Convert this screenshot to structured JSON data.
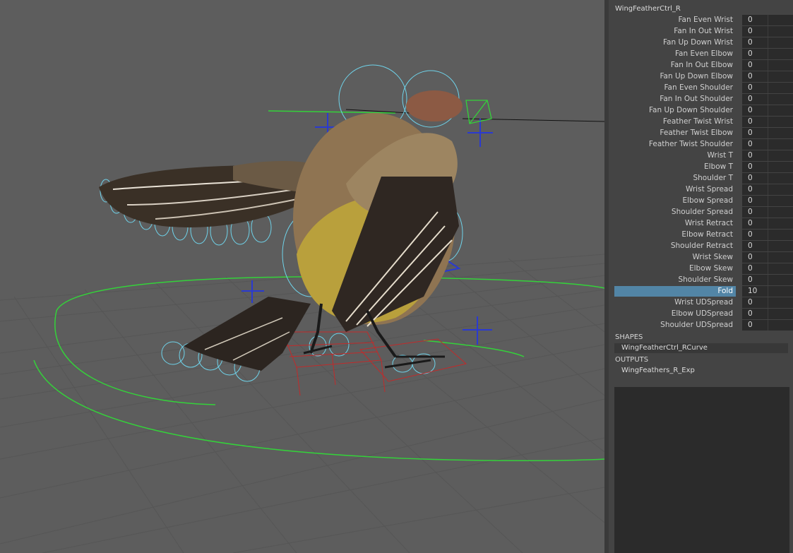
{
  "node_name": "WingFeatherCtrl_R",
  "attributes": [
    {
      "label": "Fan Even Wrist",
      "value": "0"
    },
    {
      "label": "Fan In Out Wrist",
      "value": "0"
    },
    {
      "label": "Fan Up Down Wrist",
      "value": "0"
    },
    {
      "label": "Fan Even Elbow",
      "value": "0"
    },
    {
      "label": "Fan In Out Elbow",
      "value": "0"
    },
    {
      "label": "Fan Up Down Elbow",
      "value": "0"
    },
    {
      "label": "Fan Even Shoulder",
      "value": "0"
    },
    {
      "label": "Fan In Out Shoulder",
      "value": "0"
    },
    {
      "label": "Fan Up Down Shoulder",
      "value": "0"
    },
    {
      "label": "Feather Twist Wrist",
      "value": "0"
    },
    {
      "label": "Feather Twist Elbow",
      "value": "0"
    },
    {
      "label": "Feather Twist Shoulder",
      "value": "0"
    },
    {
      "label": "Wrist T",
      "value": "0"
    },
    {
      "label": "Elbow T",
      "value": "0"
    },
    {
      "label": "Shoulder T",
      "value": "0"
    },
    {
      "label": "Wrist Spread",
      "value": "0"
    },
    {
      "label": "Elbow Spread",
      "value": "0"
    },
    {
      "label": "Shoulder Spread",
      "value": "0"
    },
    {
      "label": "Wrist Retract",
      "value": "0"
    },
    {
      "label": "Elbow Retract",
      "value": "0"
    },
    {
      "label": "Shoulder Retract",
      "value": "0"
    },
    {
      "label": "Wrist Skew",
      "value": "0"
    },
    {
      "label": "Elbow Skew",
      "value": "0"
    },
    {
      "label": "Shoulder Skew",
      "value": "0"
    },
    {
      "label": "Fold",
      "value": "10",
      "selected": true
    },
    {
      "label": "Wrist UDSpread",
      "value": "0"
    },
    {
      "label": "Elbow UDSpread",
      "value": "0"
    },
    {
      "label": "Shoulder UDSpread",
      "value": "0"
    }
  ],
  "shapes": {
    "header": "SHAPES",
    "item": "WingFeatherCtrl_RCurve"
  },
  "outputs": {
    "header": "OUTPUTS",
    "item": "WingFeathers_R_Exp"
  },
  "colors": {
    "viewport_bg": "#5d5d5d",
    "grid": "#555555",
    "nurbs_green": "#34d23a",
    "control_cyan": "#6fd3ea",
    "control_blue": "#2a3ad0",
    "joint_red": "#c22a2a",
    "selection_blue": "#5285a6"
  }
}
